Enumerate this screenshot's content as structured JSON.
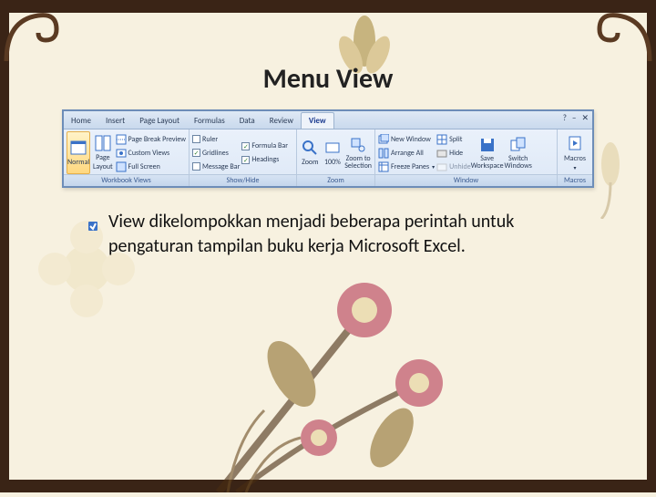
{
  "slide": {
    "title": "Menu View",
    "body": "View dikelompokkan menjadi beberapa perintah untuk pengaturan tampilan buku kerja Microsoft Excel."
  },
  "ribbon": {
    "tabs": [
      "Home",
      "Insert",
      "Page Layout",
      "Formulas",
      "Data",
      "Review",
      "View"
    ],
    "active_tab": "View",
    "right_controls": {
      "help": "?",
      "min": "‒",
      "close": "✕"
    },
    "groups": {
      "workbook_views": {
        "label": "Workbook Views",
        "normal": "Normal",
        "page_break": "Page Break Preview",
        "custom_views": "Custom Views",
        "full_screen": "Full Screen"
      },
      "show_hide": {
        "label": "Show/Hide",
        "ruler": "Ruler",
        "gridlines": "Gridlines",
        "message_bar": "Message Bar",
        "formula_bar": "Formula Bar",
        "headings": "Headings"
      },
      "zoom": {
        "label": "Zoom",
        "zoom": "Zoom",
        "hundred": "100%",
        "zoom_to_selection": "Zoom to Selection"
      },
      "window": {
        "label": "Window",
        "new_window": "New Window",
        "arrange_all": "Arrange All",
        "freeze_panes": "Freeze Panes",
        "split": "Split",
        "hide": "Hide",
        "unhide": "Unhide",
        "save_workspace": "Save Workspace",
        "switch_windows": "Switch Windows"
      },
      "macros": {
        "label": "Macros",
        "macros": "Macros"
      }
    }
  }
}
